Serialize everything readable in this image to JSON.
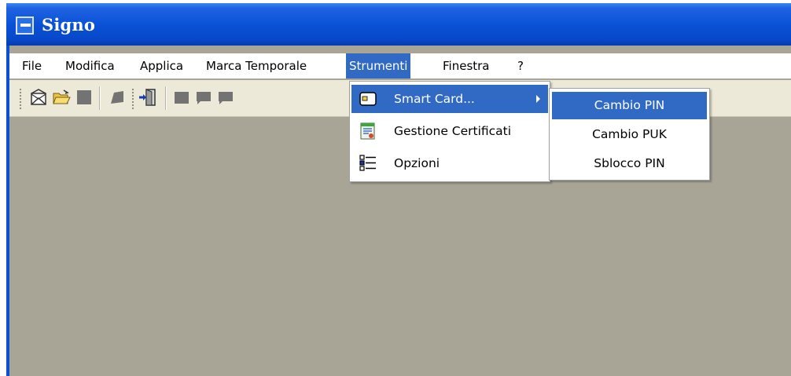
{
  "window": {
    "title": "Signo"
  },
  "menubar": {
    "items": [
      "File",
      "Modifica",
      "Applica",
      "Marca Temporale",
      "Strumenti",
      "Finestra",
      "?"
    ],
    "active": "Strumenti"
  },
  "toolbar": {
    "icons": [
      "envelope-icon",
      "open-folder-icon",
      "square-icon",
      "stamp-icon",
      "exit-door-icon",
      "square-icon",
      "speech-bubble-icon",
      "speech-bubble-icon"
    ]
  },
  "strumenti_menu": {
    "items": [
      {
        "label": "Smart Card...",
        "icon": "smart-card-icon",
        "has_submenu": true,
        "highlighted": true
      },
      {
        "label": "Gestione Certificati",
        "icon": "certificate-icon",
        "has_submenu": false,
        "highlighted": false
      },
      {
        "label": "Opzioni",
        "icon": "options-list-icon",
        "has_submenu": false,
        "highlighted": false
      }
    ]
  },
  "smart_card_submenu": {
    "items": [
      {
        "label": "Cambio PIN",
        "highlighted": true
      },
      {
        "label": "Cambio PUK",
        "highlighted": false
      },
      {
        "label": "Sblocco PIN",
        "highlighted": false
      }
    ]
  },
  "colors": {
    "titlebar": "#0a52d8",
    "highlight": "#316ac5",
    "client_background": "#a8a496",
    "toolbar_background": "#ece9d8"
  }
}
